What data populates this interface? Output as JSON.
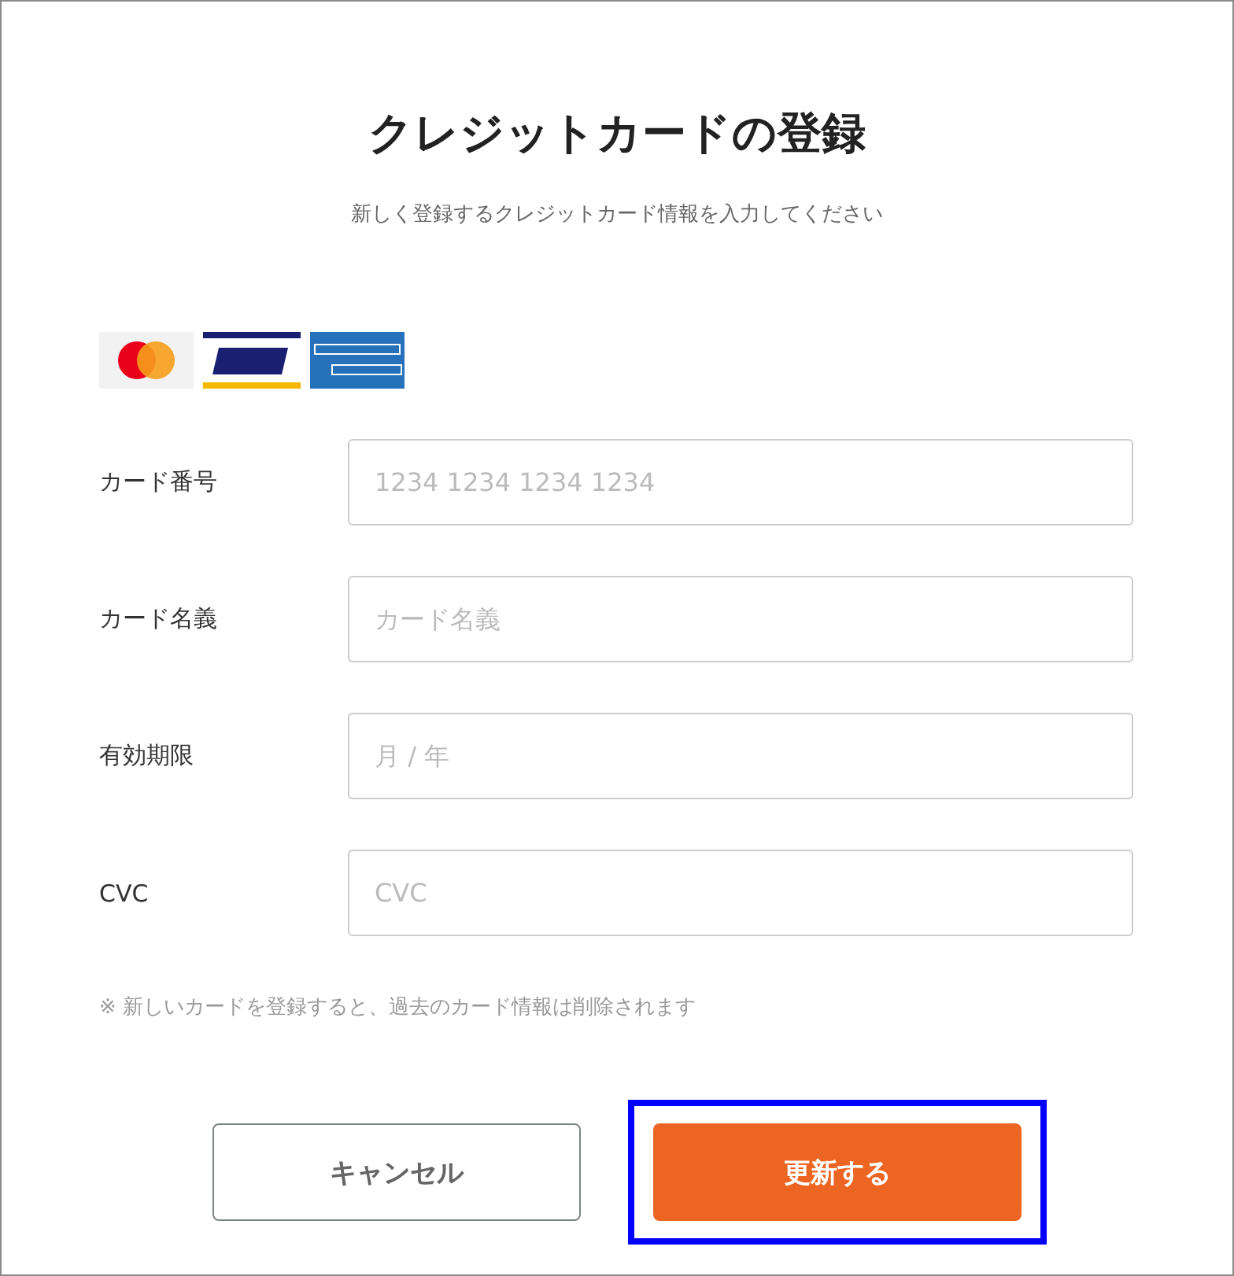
{
  "title": "クレジットカードの登録",
  "subtitle": "新しく登録するクレジットカード情報を入力してください",
  "card_brands": [
    {
      "kind": "mastercard"
    },
    {
      "kind": "visa"
    },
    {
      "kind": "amex"
    }
  ],
  "fields": [
    {
      "label": "カード番号",
      "placeholder": "1234 1234 1234 1234"
    },
    {
      "label": "カード名義",
      "placeholder": "カード名義"
    },
    {
      "label": "有効期限",
      "placeholder": "月 / 年"
    },
    {
      "label": "CVC",
      "placeholder": "CVC"
    }
  ],
  "note": "※ 新しいカードを登録すると、過去のカード情報は削除されます",
  "buttons": [
    {
      "label": "キャンセル",
      "kind": "secondary",
      "highlighted": false
    },
    {
      "label": "更新する",
      "kind": "primary",
      "highlighted": true
    }
  ]
}
